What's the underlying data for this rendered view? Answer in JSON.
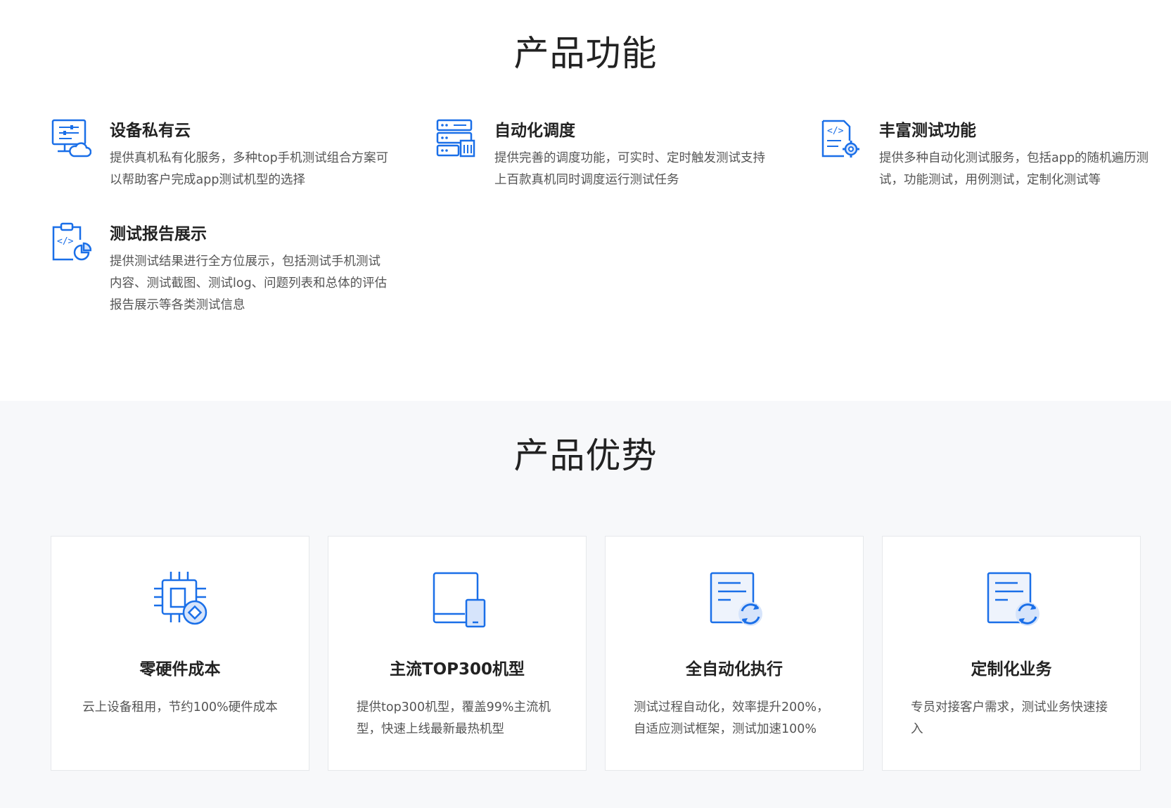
{
  "functions": {
    "title": "产品功能",
    "items": [
      {
        "icon": "monitor-cloud-icon",
        "title": "设备私有云",
        "desc": "提供真机私有化服务，多种top手机测试组合方案可以帮助客户完成app测试机型的选择"
      },
      {
        "icon": "server-schedule-icon",
        "title": "自动化调度",
        "desc": "提供完善的调度功能，可实时、定时触发测试支持上百款真机同时调度运行测试任务"
      },
      {
        "icon": "code-doc-gear-icon",
        "title": "丰富测试功能",
        "desc": "提供多种自动化测试服务，包括app的随机遍历测试，功能测试，用例测试，定制化测试等"
      },
      {
        "icon": "clipboard-chart-icon",
        "title": "测试报告展示",
        "desc": "提供测试结果进行全方位展示，包括测试手机测试内容、测试截图、测试log、问题列表和总体的评估报告展示等各类测试信息"
      }
    ]
  },
  "advantages": {
    "title": "产品优势",
    "items": [
      {
        "icon": "chip-coin-icon",
        "title": "零硬件成本",
        "desc": "云上设备租用，节约100%硬件成本"
      },
      {
        "icon": "tablet-phone-icon",
        "title": "主流TOP300机型",
        "desc": "提供top300机型，覆盖99%主流机型，快速上线最新最热机型"
      },
      {
        "icon": "doc-refresh-icon",
        "title": "全自动化执行",
        "desc": "测试过程自动化，效率提升200%，自适应测试框架，测试加速100%"
      },
      {
        "icon": "doc-refresh-icon",
        "title": "定制化业务",
        "desc": "专员对接客户需求，测试业务快速接入"
      }
    ]
  },
  "colors": {
    "accent": "#1a6fe8",
    "accent_light": "#d6e4fb",
    "bg_alt": "#f7f8fa"
  }
}
